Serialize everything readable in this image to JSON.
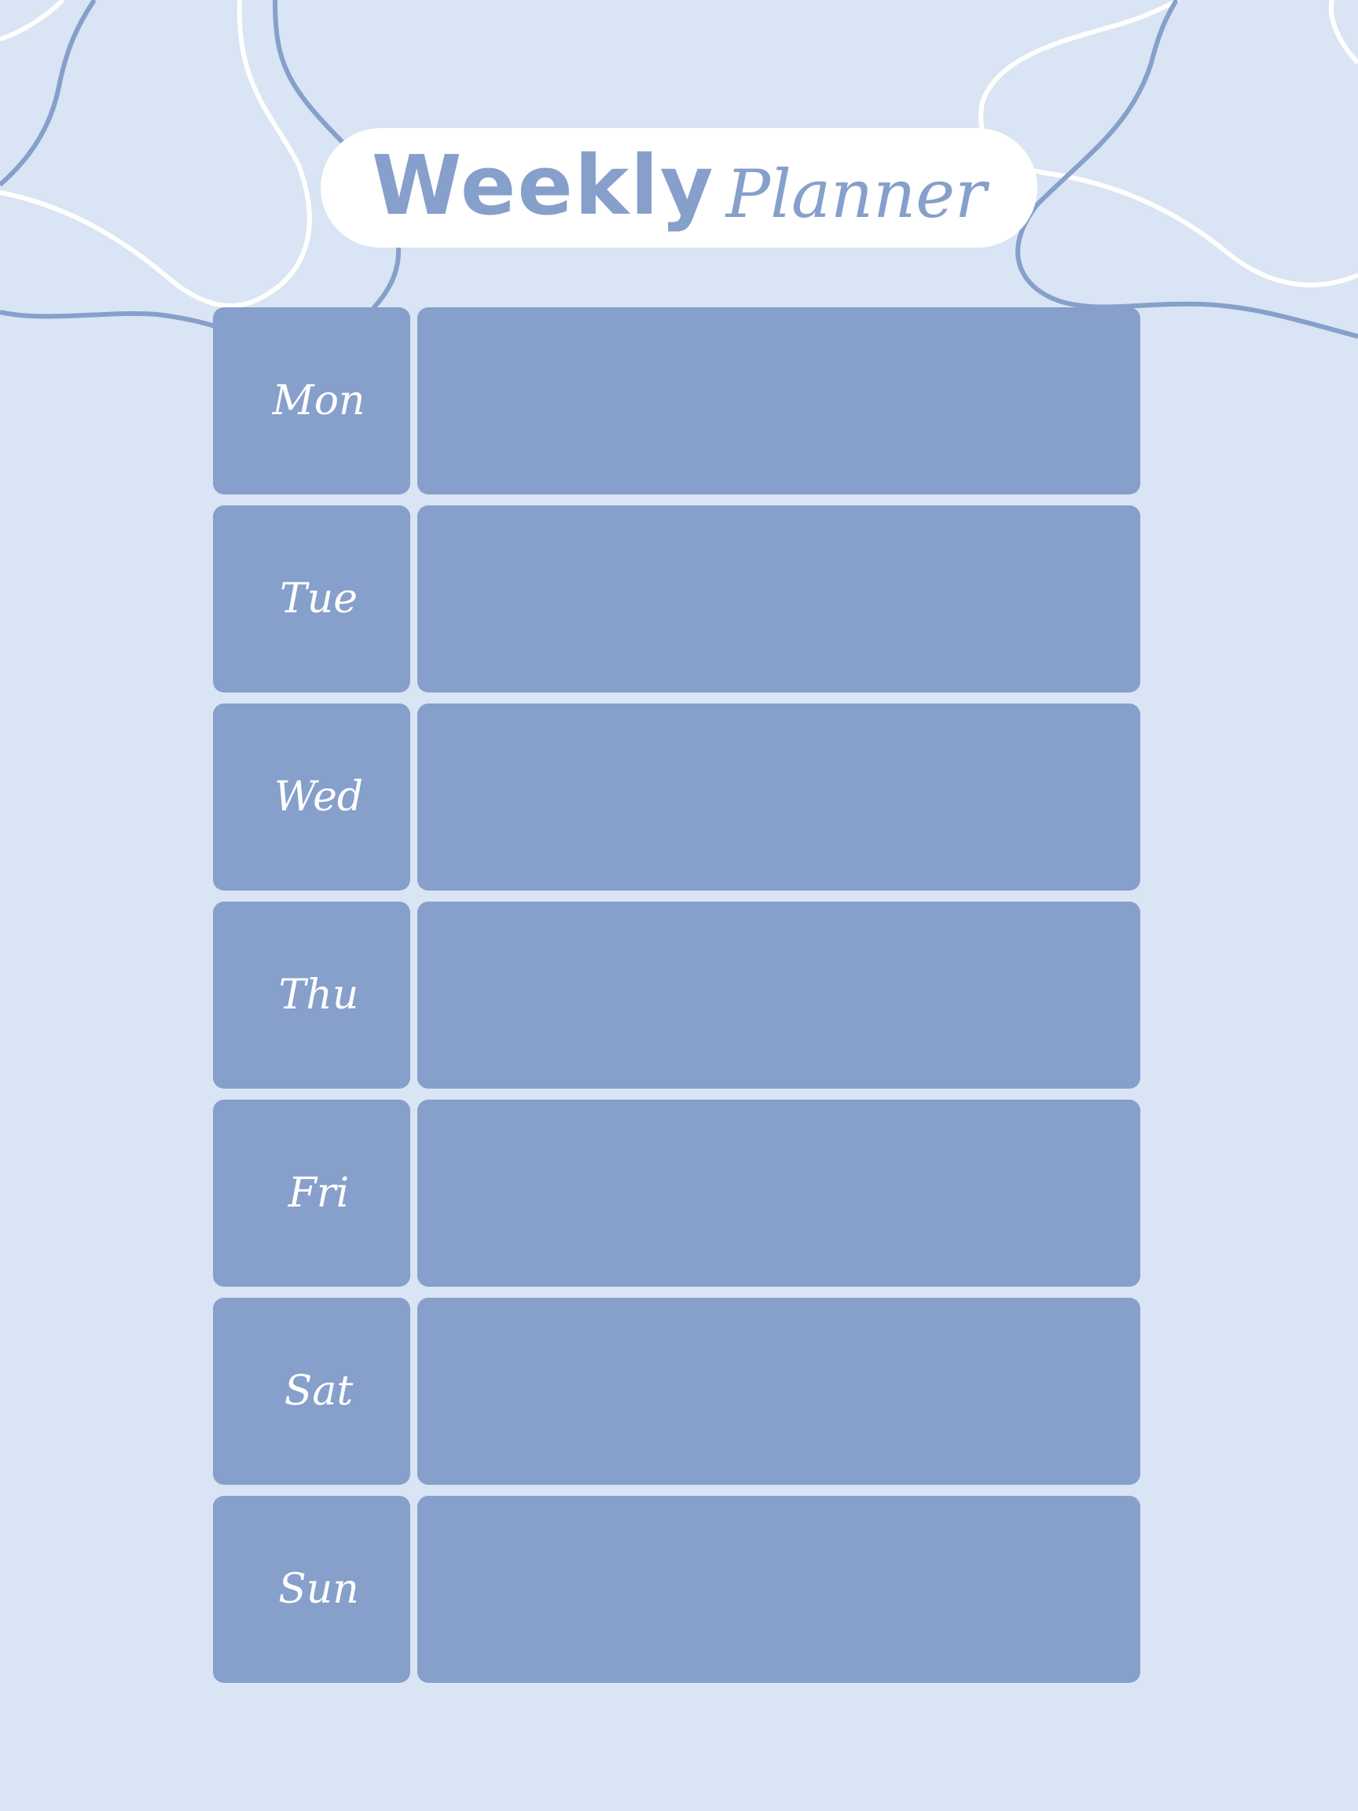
{
  "title": {
    "bold": "Weekly",
    "script": "Planner"
  },
  "days": [
    {
      "label": "Mon"
    },
    {
      "label": "Tue"
    },
    {
      "label": "Wed"
    },
    {
      "label": "Thu"
    },
    {
      "label": "Fri"
    },
    {
      "label": "Sat"
    },
    {
      "label": "Sun"
    }
  ],
  "colors": {
    "background": "#d9e4f4",
    "accent": "#869fcb",
    "pill": "#ffffff"
  }
}
